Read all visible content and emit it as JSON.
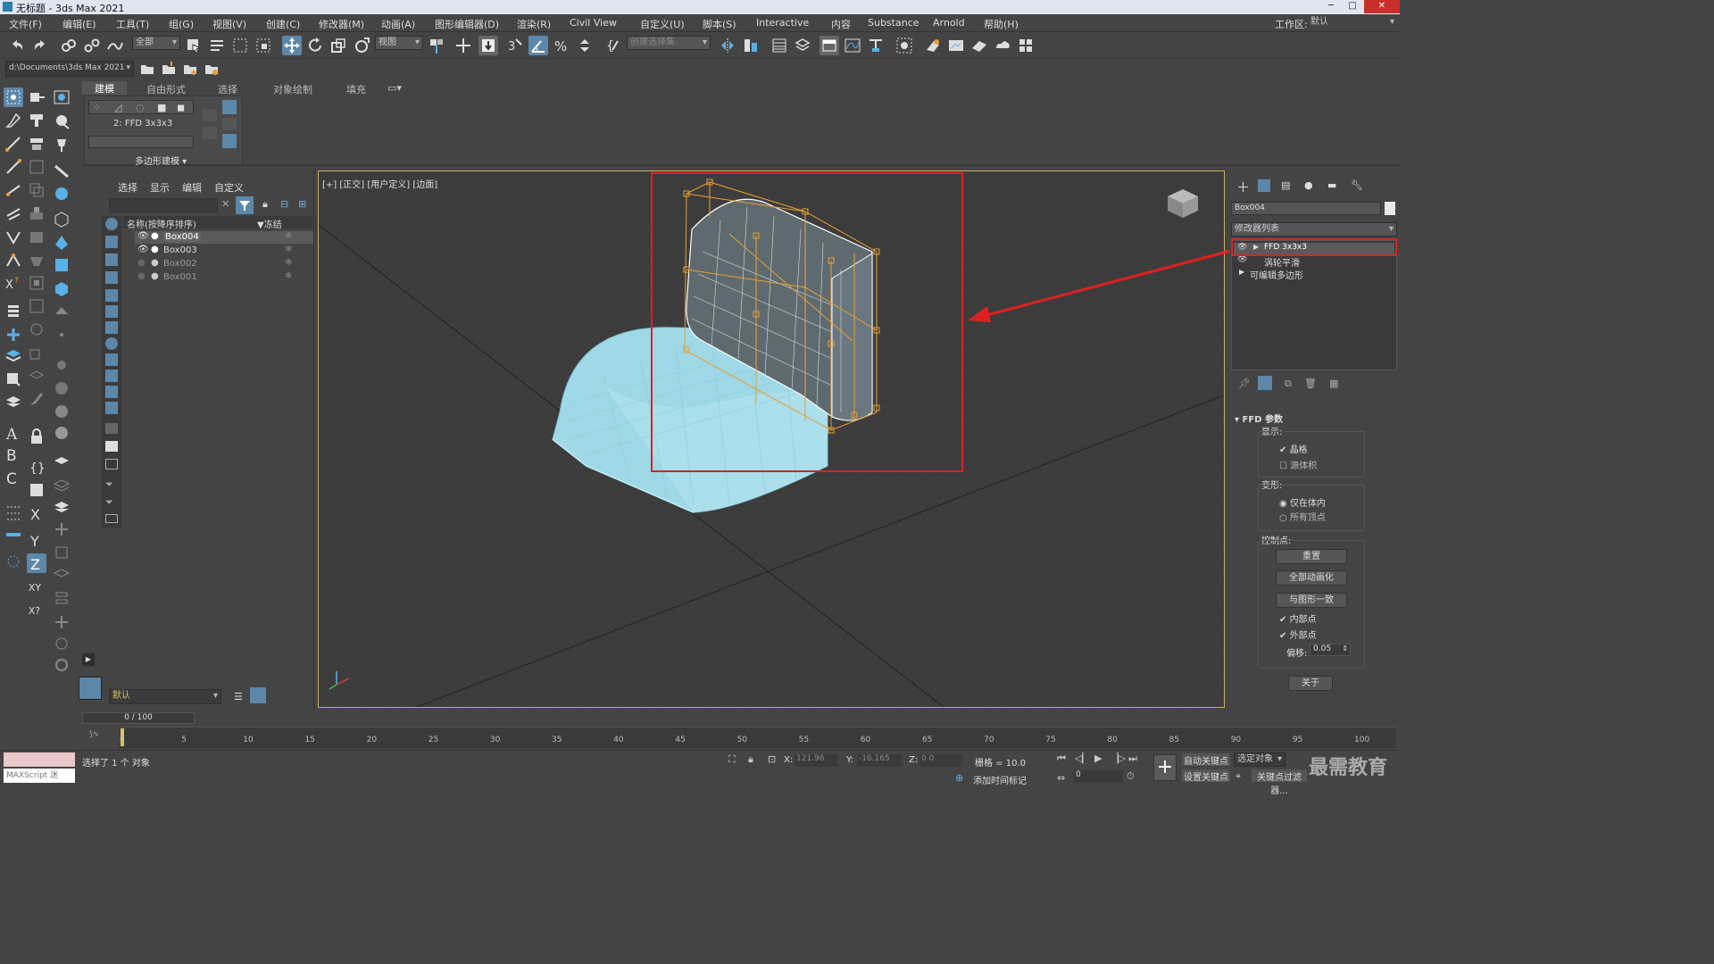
{
  "window": {
    "title": "无标题 - 3ds Max 2021",
    "minimize": "─",
    "maximize": "□",
    "close": "✕"
  },
  "menu": [
    "文件(F)",
    "编辑(E)",
    "工具(T)",
    "组(G)",
    "视图(V)",
    "创建(C)",
    "修改器(M)",
    "动画(A)",
    "图形编辑器(D)",
    "渲染(R)",
    "Civil View",
    "自定义(U)",
    "脚本(S)",
    "Interactive",
    "内容",
    "Substance",
    "Arnold",
    "帮助(H)"
  ],
  "workspace": {
    "label": "工作区:",
    "value": "默认"
  },
  "toolbar": {
    "filter_value": "全部",
    "refcoord_value": "视图",
    "selection_set_placeholder": "创建选择集"
  },
  "path": {
    "value": "d:\\Documents\\3ds Max 2021"
  },
  "ribbon": {
    "tabs": [
      "建模",
      "自由形式",
      "选择",
      "对象绘制",
      "填充"
    ],
    "panel_label": "2: FFD 3x3x3",
    "footer": "多边形建模 ▾"
  },
  "scene_explorer": {
    "tabs": [
      "选择",
      "显示",
      "编辑",
      "自定义"
    ],
    "col_name": "名称(按降序排序)",
    "col_freeze": "▼冻结",
    "rows": [
      {
        "name": "Box004",
        "selected": true
      },
      {
        "name": "Box003",
        "selected": false
      },
      {
        "name": "Box002",
        "selected": false
      },
      {
        "name": "Box001",
        "selected": false
      }
    ],
    "layer": "默认"
  },
  "viewport": {
    "label": "[+] [正交] [用户定义] [边面]"
  },
  "command_panel": {
    "object_name": "Box004",
    "modifier_list": "修改器列表",
    "stack": [
      "FFD 3x3x3",
      "涡轮平滑",
      "可编辑多边形"
    ],
    "rollout_title": "FFD 参数",
    "display_label": "显示:",
    "lattice": "晶格",
    "source_volume": "源体积",
    "deform_label": "变形:",
    "only_in_volume": "仅在体内",
    "all_vertices": "所有顶点",
    "control_points_label": "控制点:",
    "reset": "重置",
    "animate_all": "全部动画化",
    "conform_to_shape": "与图形一致",
    "inside_points": "内部点",
    "outside_points": "外部点",
    "offset_label": "偏移:",
    "offset_value": "0.05",
    "about": "关于"
  },
  "timeline": {
    "frame": "0 / 100",
    "ticks": [
      "0",
      "5",
      "10",
      "15",
      "20",
      "25",
      "30",
      "35",
      "40",
      "45",
      "50",
      "55",
      "60",
      "65",
      "70",
      "75",
      "80",
      "85",
      "90",
      "95",
      "100"
    ]
  },
  "status": {
    "maxscript": "MAXScript 迷",
    "selected_text": "选择了 1 个 对象",
    "x_label": "X:",
    "x_value": "121.96",
    "y_label": "Y:",
    "y_value": "-16.165",
    "z_label": "Z:",
    "z_value": "0.0",
    "grid": "栅格 = 10.0",
    "add_time_tag": "添加时间标记",
    "auto_key": "自动关键点",
    "selected_object": "选定对象",
    "set_key": "设置关键点",
    "key_filters": "关键点过滤器...",
    "frame_value": "0",
    "watermark": "最需教育"
  }
}
